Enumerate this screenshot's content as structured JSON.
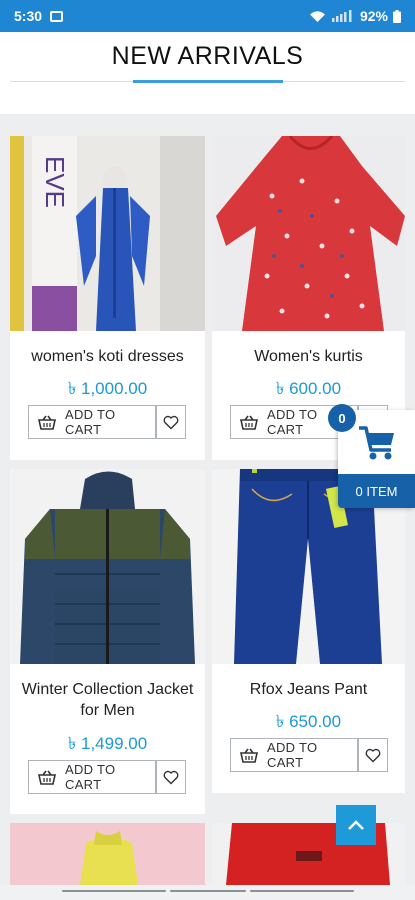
{
  "status_bar": {
    "time": "5:30",
    "battery": "92%"
  },
  "page": {
    "title": "NEW ARRIVALS"
  },
  "products": [
    {
      "name": "women's koti dresses",
      "price": "৳ 1,000.00",
      "add_to_cart": "ADD TO CART"
    },
    {
      "name": "Women's kurtis",
      "price": "৳ 600.00",
      "add_to_cart": "ADD TO CART"
    },
    {
      "name": "Winter Collection Jacket for Men",
      "price": "৳ 1,499.00",
      "add_to_cart": "ADD TO CART"
    },
    {
      "name": "Rfox Jeans Pant",
      "price": "৳ 650.00",
      "add_to_cart": "ADD TO CART"
    }
  ],
  "cart_widget": {
    "count": "0",
    "label": "0 ITEM"
  },
  "icons": {
    "gallery": "image-icon",
    "wifi": "wifi-icon",
    "signal": "signal-icon",
    "battery": "battery-icon",
    "basket": "basket-icon",
    "heart": "heart-icon",
    "cart": "shopping-cart-icon",
    "scroll_top": "chevron-up-icon"
  },
  "colors": {
    "status_bar": "#1f86d4",
    "price": "#1b9ad6",
    "cart_widget": "#1761a8",
    "scroll_top": "#1e9ad8",
    "accent": "#3c9fdc"
  }
}
